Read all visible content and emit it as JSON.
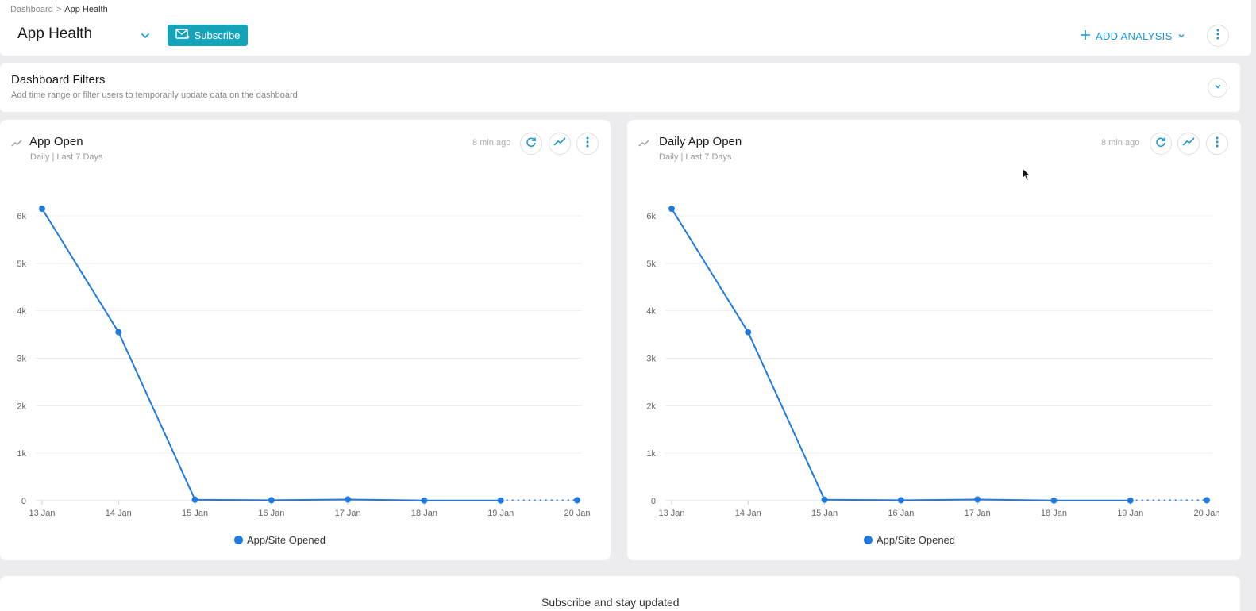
{
  "breadcrumb": {
    "root": "Dashboard",
    "separator": ">",
    "current": "App Health"
  },
  "header": {
    "title": "App Health",
    "subscribe_label": "Subscribe",
    "add_analysis_label": "ADD ANALYSIS"
  },
  "filters": {
    "title": "Dashboard Filters",
    "subtitle": "Add time range or filter users to temporarily update data on the dashboard"
  },
  "cards": [
    {
      "title": "App Open",
      "subtitle": "Daily | Last 7 Days",
      "updated": "8 min ago",
      "legend": "App/Site Opened"
    },
    {
      "title": "Daily App Open",
      "subtitle": "Daily | Last 7 Days",
      "updated": "8 min ago",
      "legend": "App/Site Opened"
    }
  ],
  "bottom": {
    "text": "Subscribe and stay updated"
  },
  "colors": {
    "accent": "#14a3b8",
    "link": "#1794d6",
    "series": "#1e7ae0"
  },
  "chart_data": [
    {
      "type": "line",
      "title": "App Open",
      "categories": [
        "13 Jan",
        "14 Jan",
        "15 Jan",
        "16 Jan",
        "17 Jan",
        "18 Jan",
        "19 Jan",
        "20 Jan"
      ],
      "y_ticks": [
        "0",
        "1k",
        "2k",
        "3k",
        "4k",
        "5k",
        "6k"
      ],
      "ylim": [
        0,
        6000
      ],
      "series": [
        {
          "name": "App/Site Opened",
          "values": [
            6150,
            3550,
            20,
            10,
            25,
            5,
            5,
            10
          ]
        }
      ],
      "dotted_last_segment": true,
      "grid": true,
      "legend_position": "bottom"
    },
    {
      "type": "line",
      "title": "Daily App Open",
      "categories": [
        "13 Jan",
        "14 Jan",
        "15 Jan",
        "16 Jan",
        "17 Jan",
        "18 Jan",
        "19 Jan",
        "20 Jan"
      ],
      "y_ticks": [
        "0",
        "1k",
        "2k",
        "3k",
        "4k",
        "5k",
        "6k"
      ],
      "ylim": [
        0,
        6000
      ],
      "series": [
        {
          "name": "App/Site Opened",
          "values": [
            6150,
            3550,
            20,
            10,
            25,
            5,
            5,
            10
          ]
        }
      ],
      "dotted_last_segment": true,
      "grid": true,
      "legend_position": "bottom"
    }
  ]
}
